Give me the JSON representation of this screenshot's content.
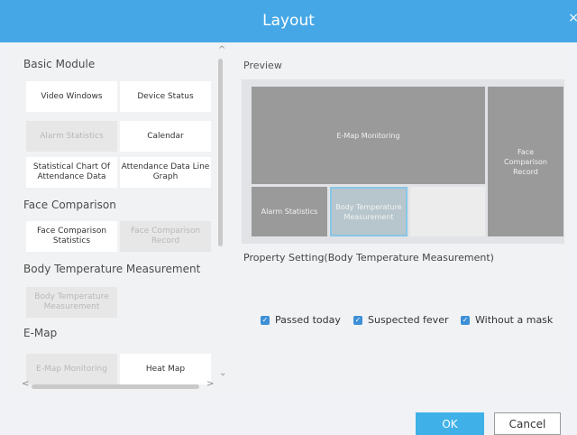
{
  "window": {
    "title": "Layout",
    "close_icon": "×"
  },
  "left": {
    "sections": {
      "basic": "Basic Module",
      "face": "Face Comparison",
      "temp": "Body Temperature Measurement",
      "emap": "E-Map"
    },
    "modules": {
      "video_windows": "Video Windows",
      "device_status": "Device Status",
      "alarm_statistics": "Alarm Statistics",
      "calendar": "Calendar",
      "stat_chart_attendance": "Statistical Chart Of Attendance Data",
      "attendance_line_graph": "Attendance Data Line Graph",
      "face_comparison_statistics": "Face Comparison Statistics",
      "face_comparison_record": "Face Comparison Record",
      "body_temp_measurement": "Body Temperature Measurement",
      "emap_monitoring": "E-Map Monitoring",
      "heat_map": "Heat Map"
    },
    "scroll": {
      "up": "^",
      "down": "⌄",
      "left": "<",
      "right": ">"
    }
  },
  "right": {
    "preview_label": "Preview",
    "preview": {
      "emap_monitoring": "E-Map Monitoring",
      "face_comparison_record": "Face Comparison Record",
      "alarm_statistics": "Alarm Statistics",
      "body_temperature_measurement": "Body Temperature Measurement"
    },
    "property_label": "Property Setting(Body Temperature Measurement)",
    "checkboxes": [
      {
        "label": "Passed today",
        "checked": true
      },
      {
        "label": "Suspected fever",
        "checked": true
      },
      {
        "label": "Without a mask",
        "checked": true
      }
    ]
  },
  "footer": {
    "ok": "OK",
    "cancel": "Cancel"
  },
  "colors": {
    "accent": "#45a7e6",
    "ok_button": "#3fb1e8",
    "checkbox": "#3d8fd6"
  }
}
